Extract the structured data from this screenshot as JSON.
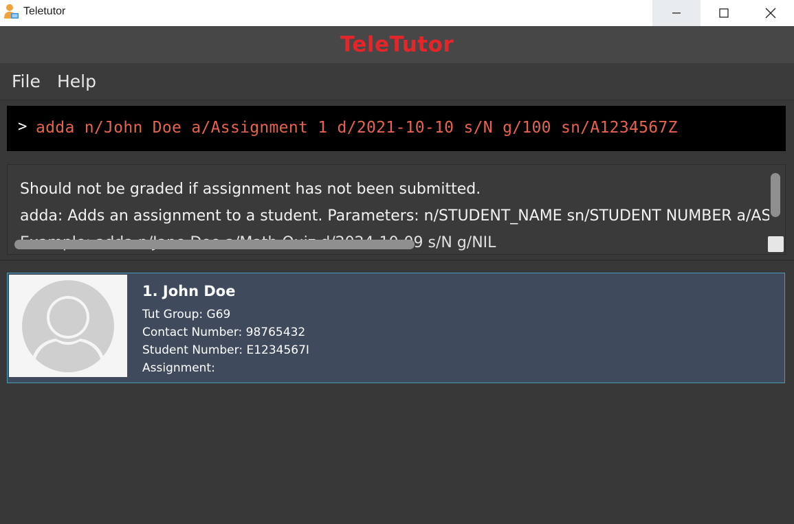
{
  "window": {
    "title": "Teletutor",
    "icon": "reading-person-icon"
  },
  "window_controls": {
    "minimize": "minimize-icon",
    "maximize": "maximize-icon",
    "close": "close-icon"
  },
  "header": {
    "title": "TeleTutor",
    "title_color": "#e5252a"
  },
  "menu": {
    "items": [
      {
        "label": "File"
      },
      {
        "label": "Help"
      }
    ]
  },
  "command": {
    "prompt": ">",
    "value": "adda n/John Doe a/Assignment 1 d/2021-10-10 s/N g/100 sn/A1234567Z",
    "text_color": "#e8634f"
  },
  "result": {
    "lines": [
      "Should not be graded if assignment has not been submitted.",
      "adda: Adds an assignment to a student. Parameters: n/STUDENT_NAME sn/STUDENT NUMBER a/ASSIGNMENT_NAME",
      "Example: adda n/Jane Doe a/Math Quiz d/2024-10-09 s/N g/NIL"
    ]
  },
  "students": [
    {
      "index_name": "1. John Doe",
      "tut_group": "Tut Group: G69",
      "contact": "Contact Number: 98765432",
      "student_number": "Student Number: E1234567I",
      "assignment": "Assignment:"
    }
  ],
  "colors": {
    "card_bg": "#3f4a5c",
    "card_border": "#4b9bb6",
    "app_bg": "#383838"
  }
}
